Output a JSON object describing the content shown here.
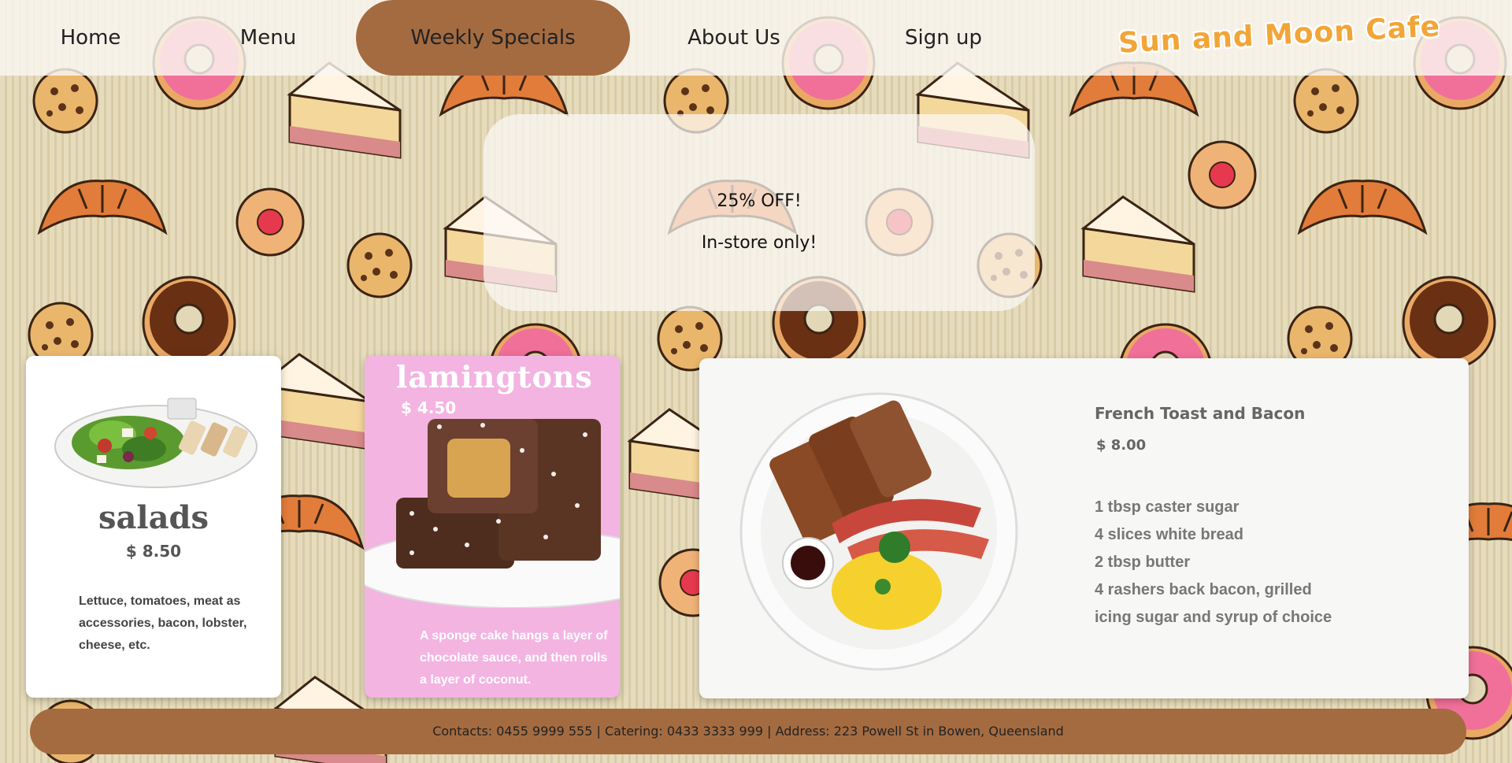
{
  "nav": {
    "items": [
      {
        "label": "Home",
        "name": "nav-home"
      },
      {
        "label": "Menu",
        "name": "nav-menu"
      },
      {
        "label": "Weekly Specials",
        "name": "nav-weekly-specials"
      },
      {
        "label": "About Us",
        "name": "nav-about-us"
      },
      {
        "label": "Sign up",
        "name": "nav-sign-up"
      }
    ],
    "active_index": 2,
    "active_color": "#a46b41"
  },
  "logo": "Sun and Moon Cafe",
  "promo": {
    "line1": "25% OFF!",
    "line2": "In-store only!"
  },
  "cards": {
    "salad": {
      "title": "salads",
      "price": "$ 8.50",
      "description": "Lettuce, tomatoes, meat as accessories, bacon, lobster, cheese, etc."
    },
    "lamingtons": {
      "title": "lamingtons",
      "price": "$ 4.50",
      "description": "A sponge cake hangs a layer of chocolate sauce, and then rolls a layer of coconut."
    },
    "french_toast": {
      "title": "French Toast and Bacon",
      "price": "$ 8.00",
      "ingredients": [
        "1 tbsp caster sugar",
        "4 slices white bread",
        "2 tbsp butter",
        "4 rashers back bacon, grilled",
        "icing sugar and syrup of choice"
      ]
    }
  },
  "footer": "Contacts: 0455 9999 555 | Catering: 0433 3333 999 | Address: 223 Powell St in Bowen, Queensland",
  "colors": {
    "brand_brown": "#a46b41",
    "logo_orange": "#f2a537",
    "lamington_pink": "#f3b4e2"
  }
}
